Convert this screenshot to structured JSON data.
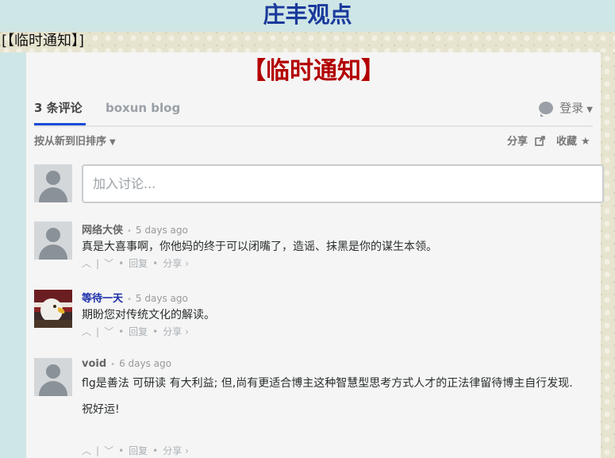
{
  "site": {
    "title": "庄丰观点",
    "breadcrumb": "[【临时通知】]"
  },
  "notice": {
    "title": "【临时通知】"
  },
  "tabs": {
    "count_label": "3 条评论",
    "blog_label": "boxun blog",
    "login_label": "登录"
  },
  "toolbar": {
    "sort_label": "按从新到旧排序",
    "share_label": "分享",
    "favorite_label": "收藏"
  },
  "compose": {
    "placeholder": "加入讨论..."
  },
  "comments": [
    {
      "author": "网络大侠",
      "time": "5 days ago",
      "text": "真是大喜事啊，你他妈的终于可以闭嘴了，造谣、抹黑是你的谋生本领。",
      "reply_label": "回复",
      "share_label": "分享 ›"
    },
    {
      "author": "等待一天",
      "time": "5 days ago",
      "text": "期盼您对传统文化的解读。",
      "reply_label": "回复",
      "share_label": "分享 ›"
    },
    {
      "author": "void",
      "time": "6 days ago",
      "text": "flg是善法 可研读 有大利益; 但,尚有更适合博主这种智慧型思考方式人才的正法律留待博主自行发现.",
      "text2": "祝好运!",
      "reply_label": "回复",
      "share_label": "分享 ›"
    }
  ],
  "colors": {
    "accent_tab": "#1a4bd6",
    "notice_red": "#b30000",
    "title_blue": "#1a3a9c"
  }
}
